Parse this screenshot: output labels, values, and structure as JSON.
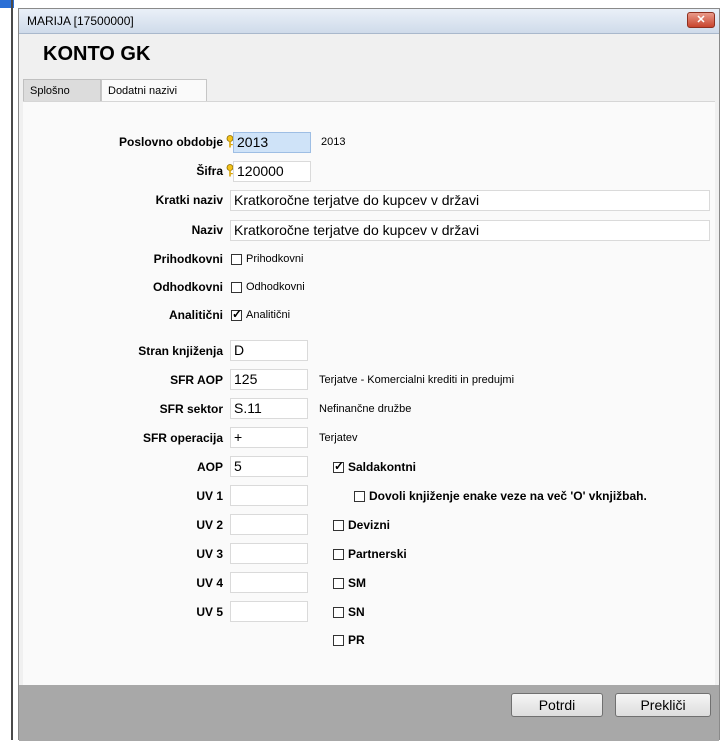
{
  "window": {
    "title": "MARIJA [17500000]",
    "close_label": "✕",
    "heading": "KONTO GK"
  },
  "tabs": [
    {
      "label": "Splošno"
    },
    {
      "label": "Dodatni nazivi"
    }
  ],
  "form": {
    "poslovno_obdobje": {
      "label": "Poslovno obdobje",
      "value": "2013",
      "note": "2013"
    },
    "sifra": {
      "label": "Šifra",
      "value": "120000"
    },
    "kratki_naziv": {
      "label": "Kratki naziv",
      "value": "Kratkoročne terjatve do kupcev v državi"
    },
    "naziv": {
      "label": "Naziv",
      "value": "Kratkoročne terjatve do kupcev v državi"
    },
    "prihodkovni": {
      "label": "Prihodkovni",
      "cb_label": "Prihodkovni",
      "checked": false
    },
    "odhodkovni": {
      "label": "Odhodkovni",
      "cb_label": "Odhodkovni",
      "checked": false
    },
    "analiticni": {
      "label": "Analitični",
      "cb_label": "Analitični",
      "checked": true
    },
    "stran_knjizenja": {
      "label": "Stran knjiženja",
      "value": "D"
    },
    "sfr_aop": {
      "label": "SFR AOP",
      "value": "125",
      "note": "Terjatve - Komercialni krediti in predujmi"
    },
    "sfr_sektor": {
      "label": "SFR sektor",
      "value": "S.11",
      "note": "Nefinančne družbe"
    },
    "sfr_operacija": {
      "label": "SFR operacija",
      "value": "+",
      "note": "Terjatev"
    },
    "aop": {
      "label": "AOP",
      "value": "5"
    },
    "uv1": {
      "label": "UV 1",
      "value": ""
    },
    "uv2": {
      "label": "UV 2",
      "value": ""
    },
    "uv3": {
      "label": "UV 3",
      "value": ""
    },
    "uv4": {
      "label": "UV 4",
      "value": ""
    },
    "uv5": {
      "label": "UV 5",
      "value": ""
    }
  },
  "options": {
    "saldakontni": {
      "label": "Saldakontni",
      "checked": true
    },
    "dovoli": {
      "label": "Dovoli knjiženje enake veze na več 'O' vknjižbah.",
      "checked": false
    },
    "devizni": {
      "label": "Devizni",
      "checked": false
    },
    "partnerski": {
      "label": "Partnerski",
      "checked": false
    },
    "sm": {
      "label": "SM",
      "checked": false
    },
    "sn": {
      "label": "SN",
      "checked": false
    },
    "pr": {
      "label": "PR",
      "checked": false
    }
  },
  "buttons": {
    "potrdi": "Potrdi",
    "preklici": "Prekliči"
  },
  "colors": {
    "focus_field": "#cfe3f8",
    "footer": "#a8a8a8",
    "close": "#c8442d"
  }
}
